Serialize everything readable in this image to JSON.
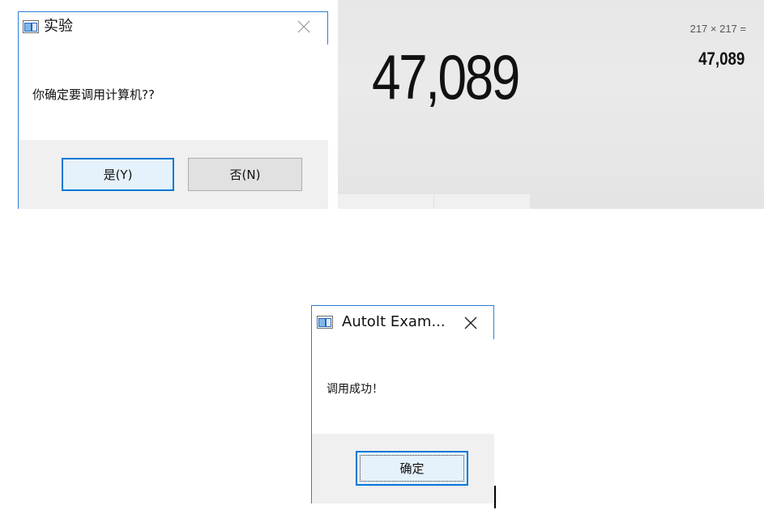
{
  "confirm_dialog": {
    "title": "实验",
    "message": "你确定要调用计算机??",
    "yes_label": "是(Y)",
    "no_label": "否(N)",
    "close_symbol": "✕"
  },
  "calculator": {
    "main_display": "47,089",
    "expression": "217  ×  217 =",
    "history_result": "47,089"
  },
  "autoit_dialog": {
    "title": "AutoIt Exam...",
    "message": "调用成功！",
    "ok_label": "确定",
    "close_symbol": "✕"
  },
  "colors": {
    "accent": "#0078d7",
    "window_border": "#2b7fd6",
    "footer_bg": "#f0f0f0"
  }
}
